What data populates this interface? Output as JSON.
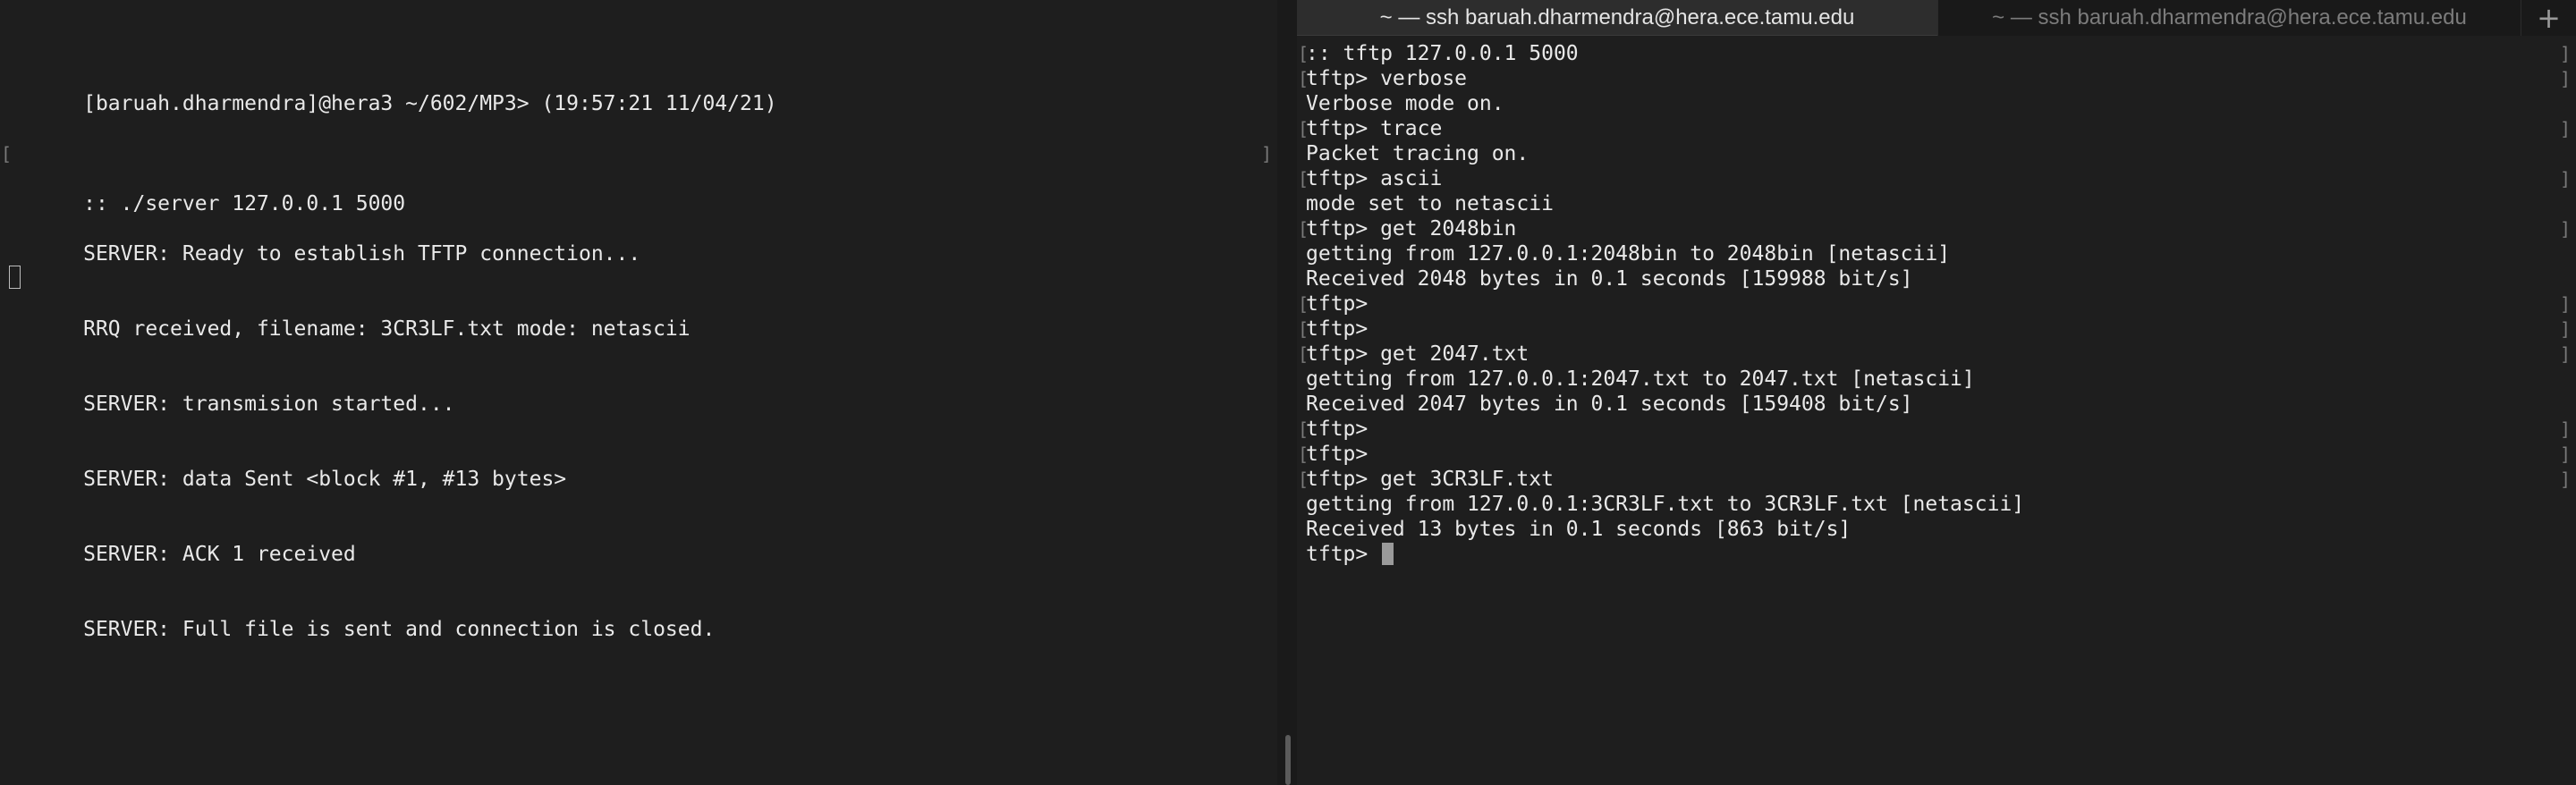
{
  "left_terminal": {
    "lines": [
      "[baruah.dharmendra]@hera3 ~/602/MP3> (19:57:21 11/04/21)",
      ":: ./server 127.0.0.1 5000",
      "SERVER: Ready to establish TFTP connection...",
      "RRQ received, filename: 3CR3LF.txt mode: netascii",
      "SERVER: transmision started...",
      "SERVER: data Sent <block #1, #13 bytes>",
      "SERVER: ACK 1 received",
      "SERVER: Full file is sent and connection is closed."
    ]
  },
  "tabs": [
    {
      "label": "~ — ssh baruah.dharmendra@hera.ece.tamu.edu",
      "active": true
    },
    {
      "label": "~ — ssh baruah.dharmendra@hera.ece.tamu.edu",
      "active": false
    }
  ],
  "new_tab_label": "+",
  "right_terminal": {
    "lines": [
      ":: tftp 127.0.0.1 5000",
      "tftp> verbose",
      "Verbose mode on.",
      "tftp> trace",
      "Packet tracing on.",
      "tftp> ascii",
      "mode set to netascii",
      "tftp> get 2048bin",
      "getting from 127.0.0.1:2048bin to 2048bin [netascii]",
      "Received 2048 bytes in 0.1 seconds [159988 bit/s]",
      "tftp>",
      "tftp>",
      "tftp> get 2047.txt",
      "getting from 127.0.0.1:2047.txt to 2047.txt [netascii]",
      "Received 2047 bytes in 0.1 seconds [159408 bit/s]",
      "tftp>",
      "tftp>",
      "tftp> get 3CR3LF.txt",
      "getting from 127.0.0.1:3CR3LF.txt to 3CR3LF.txt [netascii]",
      "Received 13 bytes in 0.1 seconds [863 bit/s]",
      "tftp> "
    ]
  },
  "colors": {
    "terminal_bg": "#1e1e1e",
    "terminal_fg": "#e9e9e9",
    "active_tab_bg": "#2d2d2d",
    "inactive_tab_bg": "#191919"
  }
}
